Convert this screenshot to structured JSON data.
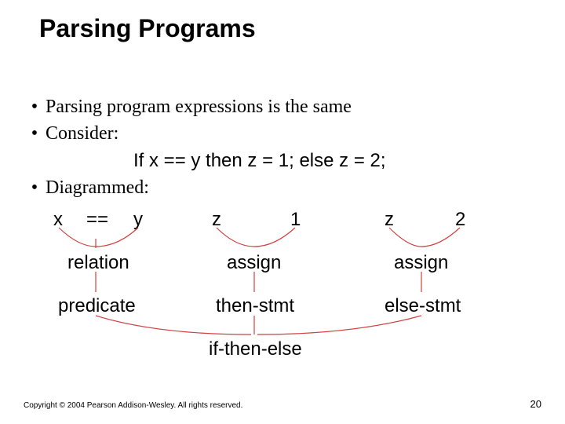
{
  "title": "Parsing Programs",
  "bullets": {
    "b1": "Parsing program expressions is the same",
    "b2": "Consider:",
    "code": "If x == y then z = 1; else z = 2;",
    "b3": "Diagrammed:"
  },
  "diagram": {
    "leaves": {
      "x": "x",
      "eq": "==",
      "y": "y",
      "z1": "z",
      "one": "1",
      "z2": "z",
      "two": "2"
    },
    "nodes": {
      "relation": "relation",
      "assign1": "assign",
      "assign2": "assign",
      "predicate": "predicate",
      "thenstmt": "then-stmt",
      "elsestmt": "else-stmt",
      "root": "if-then-else"
    }
  },
  "footer": "Copyright © 2004 Pearson Addison-Wesley. All rights reserved.",
  "page": "20"
}
